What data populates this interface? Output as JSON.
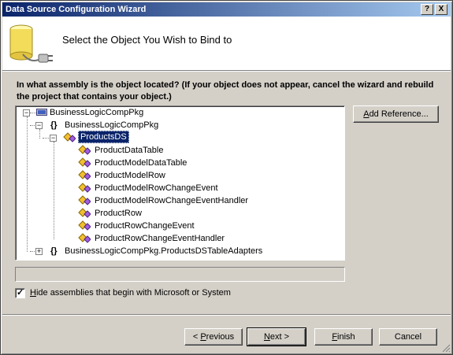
{
  "window": {
    "title": "Data Source Configuration Wizard",
    "help_button": "?",
    "close_button": "X"
  },
  "header": {
    "title": "Select the Object You Wish to Bind to",
    "icon": "database-plug-icon"
  },
  "question": "In what assembly is the object located? (If your object does not appear, cancel the wizard and rebuild the project that contains your object.)",
  "tree": {
    "root": "BusinessLogicCompPkg",
    "namespace": "BusinessLogicCompPkg",
    "selected_class": "ProductsDS",
    "children": [
      "ProductDataTable",
      "ProductModelDataTable",
      "ProductModelRow",
      "ProductModelRowChangeEvent",
      "ProductModelRowChangeEventHandler",
      "ProductRow",
      "ProductRowChangeEvent",
      "ProductRowChangeEventHandler"
    ],
    "collapsed_namespace": "BusinessLogicCompPkg.ProductsDSTableAdapters"
  },
  "add_reference_button": {
    "accel": "A",
    "rest": "dd Reference..."
  },
  "hide_assemblies": {
    "checked": true,
    "accel": "H",
    "rest": "ide assemblies that begin with Microsoft or System"
  },
  "buttons": {
    "previous": {
      "prefix": "< ",
      "accel": "P",
      "rest": "revious"
    },
    "next": {
      "accel": "N",
      "rest": "ext >"
    },
    "finish": {
      "accel": "F",
      "rest": "inish"
    },
    "cancel": "Cancel"
  }
}
